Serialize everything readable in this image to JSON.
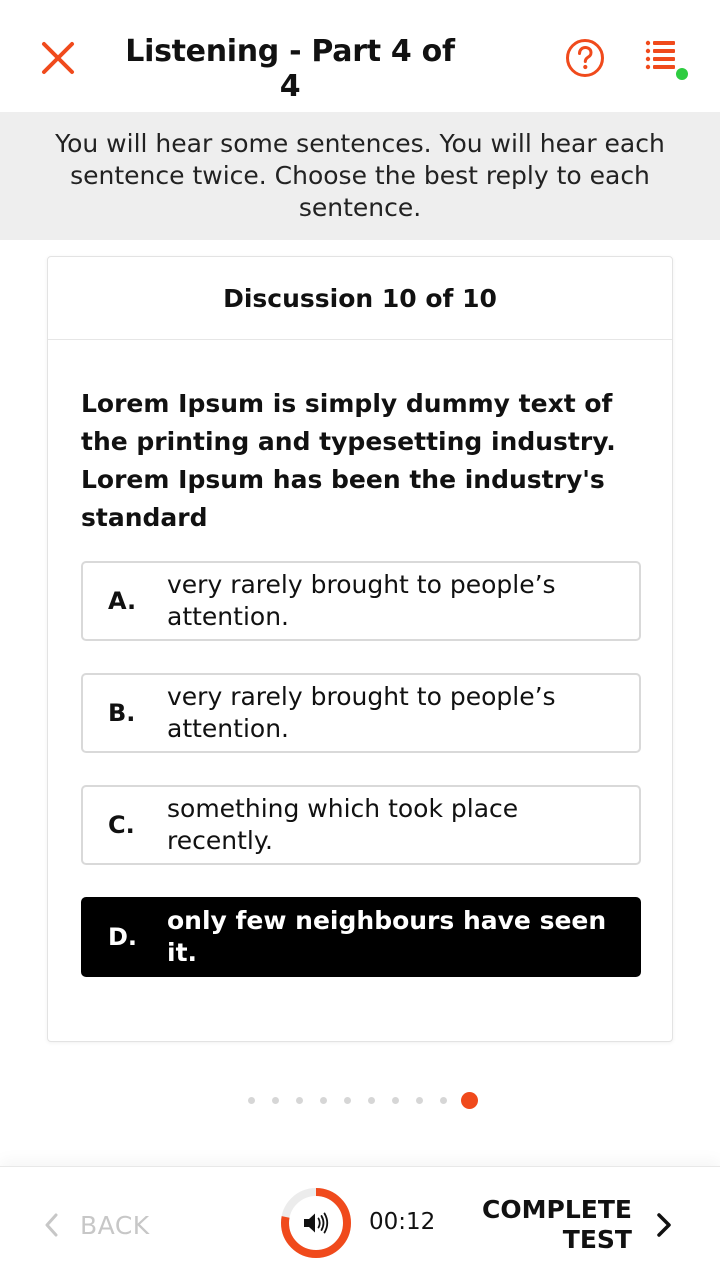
{
  "header": {
    "title": "Listening - Part 4 of 4",
    "close_icon": "close-icon",
    "help_icon": "help-circle-icon",
    "list_icon": "question-list-icon",
    "accent_color": "#f04a1c",
    "status_dot_color": "#2ecc40"
  },
  "instructions": "You will hear some sentences. You will hear each sentence twice. Choose the best reply to each sentence.",
  "card": {
    "header": "Discussion 10 of 10",
    "question": "Lorem Ipsum is simply dummy text of the printing and typesetting industry. Lorem Ipsum has been the industry's standard",
    "options": [
      {
        "letter": "A.",
        "text": "very rarely brought to people’s attention.",
        "selected": false
      },
      {
        "letter": "B.",
        "text": "very rarely brought to people’s attention.",
        "selected": false
      },
      {
        "letter": "C.",
        "text": "something which took place recently.",
        "selected": false
      },
      {
        "letter": "D.",
        "text": "only few neighbours have seen it.",
        "selected": true
      }
    ]
  },
  "pagination": {
    "total": 10,
    "current": 10
  },
  "footer": {
    "back_label": "BACK",
    "timer": "00:12",
    "audio_progress": 0.78,
    "complete_label_line1": "COMPLETE",
    "complete_label_line2": "TEST"
  }
}
